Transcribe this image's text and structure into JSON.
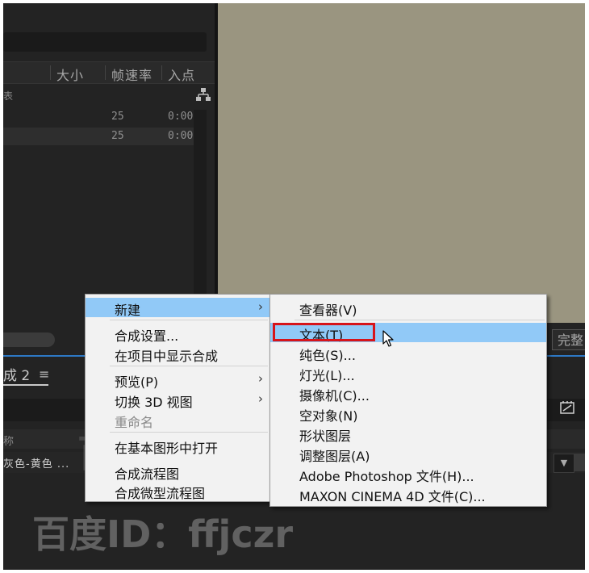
{
  "project_panel": {
    "columns": [
      "大小",
      "帧速率",
      "入点"
    ],
    "rows": [
      {
        "fps": "25",
        "in_point": "0:00"
      },
      {
        "fps": "25",
        "in_point": "0:00"
      }
    ],
    "fragment_text": "表"
  },
  "viewer": {
    "background_color": "#9a9580",
    "full_button": "完整"
  },
  "timeline": {
    "tab_label": "成 2",
    "tab_menu_icon": "≡",
    "column_fragment": "称",
    "layer_name": "灰色-黄色 ...",
    "dropdown_icon": "chevron-down-icon"
  },
  "context_menu": {
    "items": [
      {
        "label": "新建",
        "submenu": "›",
        "highlighted": true
      },
      {
        "label": "合成设置..."
      },
      {
        "label": "在项目中显示合成"
      },
      {
        "label": "预览(P)",
        "submenu": "›"
      },
      {
        "label": "切换 3D 视图",
        "submenu": "›"
      },
      {
        "label": "重命名",
        "disabled": true
      },
      {
        "label": "在基本图形中打开"
      },
      {
        "label": "合成流程图"
      },
      {
        "label": "合成微型流程图"
      }
    ]
  },
  "submenu": {
    "items": [
      {
        "label": "查看器(V)"
      },
      {
        "label": "文本(T)",
        "highlighted": true
      },
      {
        "label": "纯色(S)..."
      },
      {
        "label": "灯光(L)..."
      },
      {
        "label": "摄像机(C)..."
      },
      {
        "label": "空对象(N)"
      },
      {
        "label": "形状图层"
      },
      {
        "label": "调整图层(A)"
      },
      {
        "label": "Adobe Photoshop 文件(H)..."
      },
      {
        "label": "MAXON CINEMA 4D 文件(C)..."
      }
    ]
  },
  "watermarks": [
    "百度ID：ffjczr",
    "百度ID：ffjczr",
    "百度ID：ffjczr"
  ],
  "colors": {
    "menu_highlight": "#91c9f7",
    "annotation_red": "#d7141a",
    "accent_blue": "#2d78c4"
  }
}
